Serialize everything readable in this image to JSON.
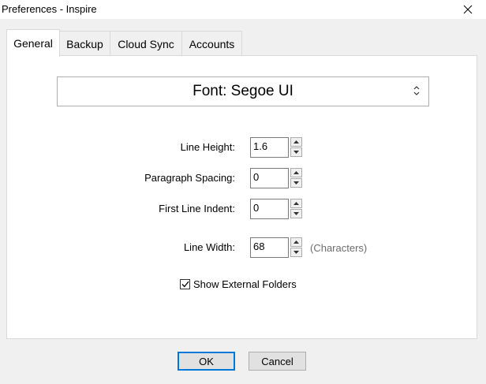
{
  "window": {
    "title": "Preferences - Inspire"
  },
  "tabs": [
    {
      "label": "General",
      "active": true
    },
    {
      "label": "Backup",
      "active": false
    },
    {
      "label": "Cloud Sync",
      "active": false
    },
    {
      "label": "Accounts",
      "active": false
    }
  ],
  "general": {
    "font_select": {
      "value": "Font: Segoe UI"
    },
    "line_height": {
      "label": "Line Height:",
      "value": "1.6"
    },
    "paragraph_spacing": {
      "label": "Paragraph Spacing:",
      "value": "0"
    },
    "first_line_indent": {
      "label": "First Line Indent:",
      "value": "0"
    },
    "line_width": {
      "label": "Line Width:",
      "value": "68",
      "hint": "(Characters)"
    },
    "show_external_folders": {
      "label": "Show External Folders",
      "checked": true
    }
  },
  "buttons": {
    "ok": "OK",
    "cancel": "Cancel"
  },
  "colors": {
    "accent": "#0078d7",
    "panel": "#ffffff",
    "chrome": "#f0f0f0"
  },
  "icons": {
    "close": "close-icon",
    "select_chevron": "chevron-updown-icon",
    "spin_up": "arrow-up-icon",
    "spin_down": "arrow-down-icon",
    "checkmark": "checkmark-icon"
  }
}
